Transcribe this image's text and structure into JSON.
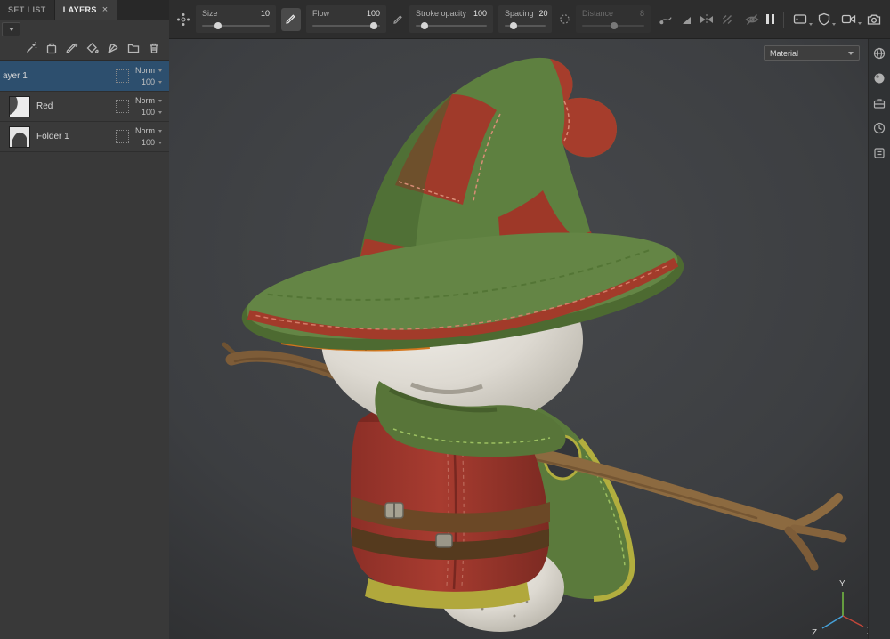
{
  "colors": {
    "selection": "#2d4f6e",
    "accent-blue": "#4aa0e0",
    "axis-y": "#76c043",
    "axis-z": "#46a1d9",
    "axis-x": "#c4473a"
  },
  "left_panel": {
    "tabs": [
      {
        "label": "SET LIST"
      },
      {
        "label": "LAYERS",
        "close": "×"
      }
    ],
    "layers": [
      {
        "name": "ayer 1",
        "blend": "Norm",
        "opacity": "100",
        "selected": true
      },
      {
        "name": "Red",
        "blend": "Norm",
        "opacity": "100",
        "selected": false
      },
      {
        "name": "Folder 1",
        "blend": "Norm",
        "opacity": "100",
        "selected": false
      }
    ]
  },
  "toolbar": {
    "size": {
      "label": "Size",
      "value": "10"
    },
    "flow": {
      "label": "Flow",
      "value": "100"
    },
    "stroke_opacity": {
      "label": "Stroke opacity",
      "value": "100"
    },
    "spacing": {
      "label": "Spacing",
      "value": "20"
    },
    "distance": {
      "label": "Distance",
      "value": "8"
    }
  },
  "viewport": {
    "material_label": "Material",
    "gizmo": {
      "x": "X",
      "y": "Y",
      "z": "Z"
    }
  }
}
